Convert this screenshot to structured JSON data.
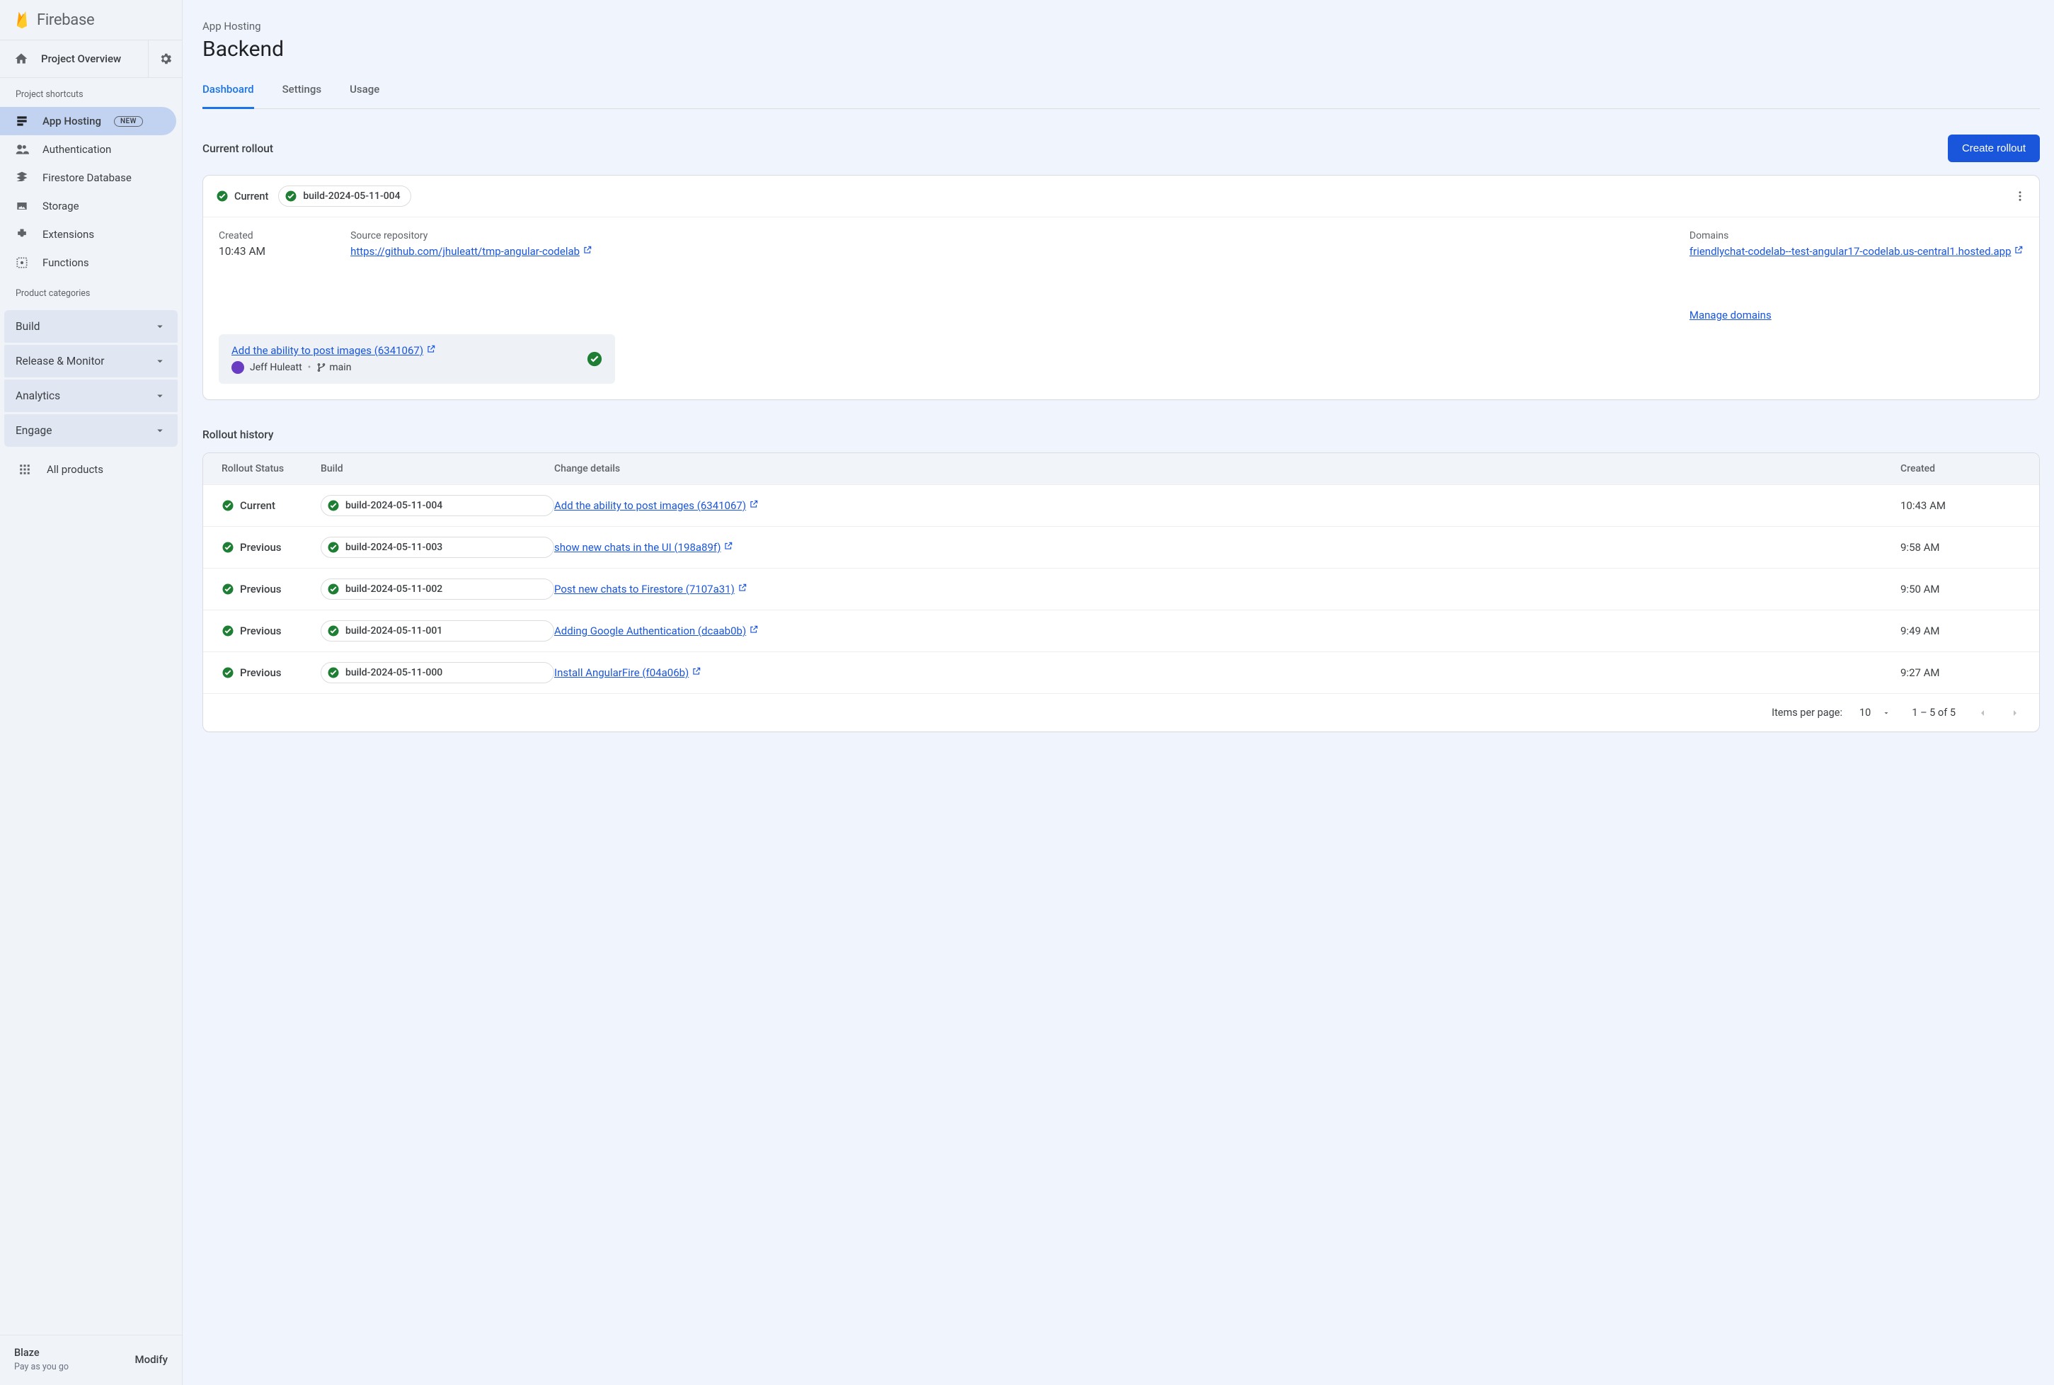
{
  "brand": "Firebase",
  "project": {
    "overview": "Project Overview"
  },
  "shortcuts_label": "Project shortcuts",
  "shortcuts": [
    {
      "label": "App Hosting",
      "badge": "NEW",
      "active": true
    },
    {
      "label": "Authentication"
    },
    {
      "label": "Firestore Database"
    },
    {
      "label": "Storage"
    },
    {
      "label": "Extensions"
    },
    {
      "label": "Functions"
    }
  ],
  "categories_label": "Product categories",
  "categories": [
    "Build",
    "Release & Monitor",
    "Analytics",
    "Engage"
  ],
  "all_products": "All products",
  "plan": {
    "name": "Blaze",
    "sub": "Pay as you go",
    "modify": "Modify"
  },
  "breadcrumb": "App Hosting",
  "page_title": "Backend",
  "tabs": [
    "Dashboard",
    "Settings",
    "Usage"
  ],
  "active_tab_index": 0,
  "current_rollout": {
    "section_title": "Current rollout",
    "create_button": "Create rollout",
    "status": "Current",
    "build": "build-2024-05-11-004",
    "created_label": "Created",
    "created_value": "10:43 AM",
    "source_label": "Source repository",
    "source_url": "https://github.com/jhuleatt/tmp-angular-codelab",
    "commit_title": "Add the ability to post images (6341067)",
    "commit_author": "Jeff Huleatt",
    "commit_branch": "main",
    "domains_label": "Domains",
    "domain_url": "friendlychat-codelab--test-angular17-codelab.us-central1.hosted.app",
    "manage_domains": "Manage domains"
  },
  "history": {
    "title": "Rollout history",
    "columns": {
      "status": "Rollout Status",
      "build": "Build",
      "change": "Change details",
      "created": "Created"
    },
    "rows": [
      {
        "status": "Current",
        "build": "build-2024-05-11-004",
        "change": "Add the ability to post images (6341067)",
        "created": "10:43 AM"
      },
      {
        "status": "Previous",
        "build": "build-2024-05-11-003",
        "change": "show new chats in the UI (198a89f)",
        "created": "9:58 AM"
      },
      {
        "status": "Previous",
        "build": "build-2024-05-11-002",
        "change": "Post new chats to Firestore (7107a31)",
        "created": "9:50 AM"
      },
      {
        "status": "Previous",
        "build": "build-2024-05-11-001",
        "change": "Adding Google Authentication (dcaab0b)",
        "created": "9:49 AM"
      },
      {
        "status": "Previous",
        "build": "build-2024-05-11-000",
        "change": "Install AngularFire (f04a06b)",
        "created": "9:27 AM"
      }
    ],
    "footer": {
      "per_page_label": "Items per page:",
      "per_page_value": "10",
      "range": "1 – 5 of 5"
    }
  }
}
